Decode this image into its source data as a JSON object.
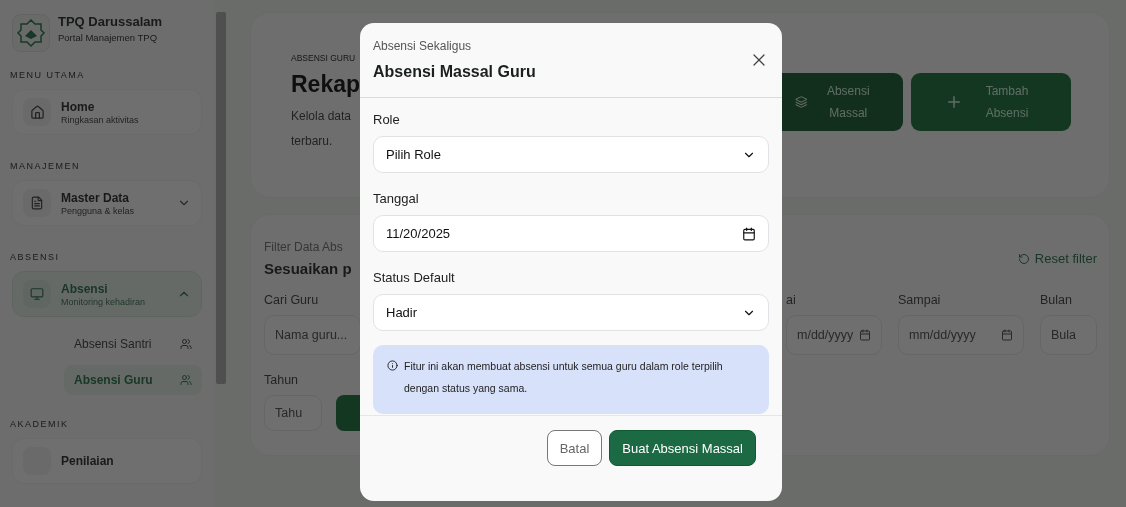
{
  "sidebar": {
    "brand": {
      "name": "TPQ Darussalam",
      "tagline": "Portal Manajemen TPQ"
    },
    "sections": [
      {
        "title": "MENU UTAMA",
        "items": [
          {
            "kind": "link",
            "label": "Home",
            "sub": "Ringkasan aktivitas",
            "selected": false
          }
        ]
      },
      {
        "title": "MANAJEMEN",
        "items": [
          {
            "kind": "group",
            "label": "Master Data",
            "sub": "Pengguna & kelas",
            "selected": false,
            "expanded": false
          }
        ]
      },
      {
        "title": "ABSENSI",
        "items": [
          {
            "kind": "group",
            "label": "Absensi",
            "sub": "Monitoring kehadiran",
            "selected": true,
            "expanded": true,
            "children": [
              {
                "label": "Absensi Santri",
                "selected": false
              },
              {
                "label": "Absensi Guru",
                "selected": true
              }
            ]
          }
        ]
      },
      {
        "title": "AKADEMIK",
        "items": [
          {
            "kind": "link",
            "label": "Penilaian",
            "selected": false
          }
        ]
      }
    ]
  },
  "header": {
    "eyebrow": "ABSENSI GURU",
    "title": "Rekap",
    "lines": [
      "Kelola data",
      "terbaru."
    ],
    "actions": [
      {
        "kind": "secondary",
        "label": "Absensi Massal"
      },
      {
        "kind": "primary",
        "label": "Tambah Absensi"
      }
    ]
  },
  "filter": {
    "eyebrow": "Filter Data Abs",
    "title": "Sesuaikan p",
    "reset": "Reset filter",
    "fields": [
      {
        "kind": "text",
        "label": "Cari Guru",
        "placeholder": "Nama guru..."
      },
      {
        "kind": "gap"
      },
      {
        "kind": "date",
        "label": "ai",
        "placeholder": "m/dd/yyyy"
      },
      {
        "kind": "date",
        "label": "Sampai",
        "placeholder": "mm/dd/yyyy"
      },
      {
        "kind": "select",
        "label": "Bulan",
        "placeholder": "Bula"
      }
    ],
    "year": {
      "label": "Tahun",
      "placeholder": "Tahu"
    }
  },
  "modal": {
    "eyebrow": "Absensi Sekaligus",
    "title": "Absensi Massal Guru",
    "fields": [
      {
        "kind": "select",
        "label": "Role",
        "value": "Pilih Role"
      },
      {
        "kind": "date",
        "label": "Tanggal",
        "value": "11/20/2025"
      },
      {
        "kind": "select",
        "label": "Status Default",
        "value": "Hadir"
      }
    ],
    "info": "Fitur ini akan membuat absensi untuk semua guru dalam role terpilih dengan status yang sama.",
    "buttons": [
      {
        "kind": "secondary",
        "label": "Batal"
      },
      {
        "kind": "primary",
        "label": "Buat Absensi Massal"
      }
    ]
  }
}
